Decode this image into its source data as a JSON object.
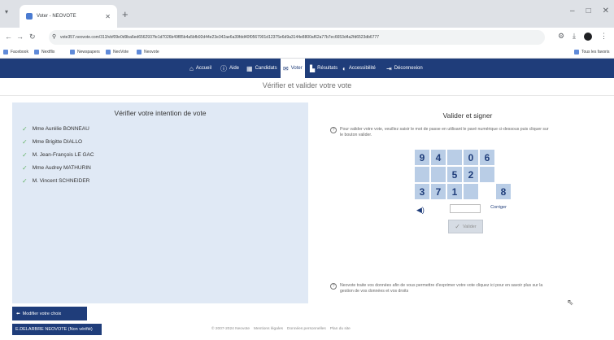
{
  "browser": {
    "tab_title": "Voter - NEOVOTE",
    "new_tab": "+",
    "url": "vote357.neovote.com/313/vbf09e0d9ba6ed6562937fe1d7026b49f85b4a5bfb92d44e23e342ae6a39fdd40f0567901d12375e6d9a3144e8800af62a77b7ec6653d4a2fd6523db6777",
    "bookmarks": [
      "Facebook",
      "Nextflix",
      "Newspapers",
      "NeoVote",
      "Neovote"
    ],
    "other_bookmarks": "Tous les favoris"
  },
  "nav": {
    "home": "Accueil",
    "help": "Aide",
    "candidates": "Candidats",
    "vote": "Voter",
    "results": "Résultats",
    "accessibility": "Accessibilité",
    "logout": "Déconnexion"
  },
  "page_subtitle": "Vérifier et valider votre vote",
  "left_panel": {
    "title": "Vérifier votre intention de vote",
    "candidates": [
      "Mme Aurélie BONNEAU",
      "Mme Brigitte DIALLO",
      "M. Jean-François LE GAC",
      "Mme Audrey MATHURIN",
      "M. Vincent SCHNEIDER"
    ]
  },
  "right_panel": {
    "title": "Valider et signer",
    "instructions": "Pour valider votre vote, veuillez saisir le mot de passe en utilisant le pavé numérique ci-dessous puis cliquer sur le bouton valider.",
    "keypad_keys": [
      "9",
      "4",
      "",
      "0",
      "6",
      "",
      "",
      "5",
      "2",
      "",
      "3",
      "7",
      "1",
      "",
      "8"
    ],
    "correct_label": "Corriger",
    "validate_label": "Valider",
    "privacy_note": "Neovote traite vos données afin de vous permettre d'exprimer votre vote cliquez ici pour en savoir plus sur la gestion de vos données et vos droits"
  },
  "footer": {
    "modify_button": "Modifier votre choix",
    "user_badge": "E.DELARBRE NEOVOTE (Non vérifié)",
    "copyright": "© 2007-2024 Neovote",
    "links": [
      "Mentions légales",
      "Données personnelles",
      "Plan du site"
    ]
  },
  "colors": {
    "brand_blue": "#1f3d7a",
    "panel_bg": "#e0e9f5",
    "key_bg": "#b9cde6",
    "check_green": "#68b56b"
  }
}
